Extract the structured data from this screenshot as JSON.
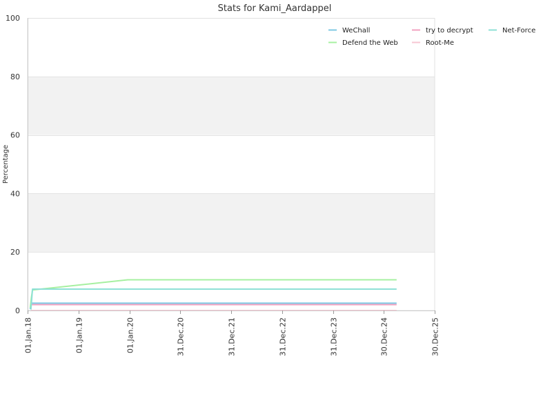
{
  "chart_data": {
    "type": "line",
    "title": "Stats for Kami_Aardappel",
    "xlabel": "",
    "ylabel": "Percentage",
    "ylim": [
      0,
      100
    ],
    "yticks": [
      0,
      20,
      40,
      60,
      80,
      100
    ],
    "xlim": [
      "2018-01-01",
      "2025-12-30"
    ],
    "xticks": [
      {
        "date": "2018-01-01",
        "label": "01.Jan.18"
      },
      {
        "date": "2019-01-01",
        "label": "01.Jan.19"
      },
      {
        "date": "2020-01-01",
        "label": "01.Jan.20"
      },
      {
        "date": "2020-12-31",
        "label": "31.Dec.20"
      },
      {
        "date": "2021-12-31",
        "label": "31.Dec.21"
      },
      {
        "date": "2022-12-31",
        "label": "31.Dec.22"
      },
      {
        "date": "2023-12-31",
        "label": "31.Dec.23"
      },
      {
        "date": "2024-12-30",
        "label": "30.Dec.24"
      },
      {
        "date": "2025-12-30",
        "label": "30.Dec.25"
      }
    ],
    "grid": true,
    "alternating_bands": true,
    "legend_position": "top-right",
    "series": [
      {
        "name": "WeChall",
        "color": "#7ec8e3",
        "points": [
          [
            "2018-01-20",
            0.5
          ],
          [
            "2018-01-25",
            2.5
          ],
          [
            "2025-04-01",
            2.5
          ]
        ]
      },
      {
        "name": "Defend the Web",
        "color": "#a6f0a0",
        "points": [
          [
            "2018-01-20",
            1.0
          ],
          [
            "2018-01-28",
            4.5
          ],
          [
            "2018-02-05",
            7.0
          ],
          [
            "2019-12-20",
            10.5
          ],
          [
            "2025-04-01",
            10.5
          ]
        ]
      },
      {
        "name": "try to decrypt",
        "color": "#f2a2c0",
        "points": [
          [
            "2018-01-25",
            2.0
          ],
          [
            "2025-04-01",
            2.0
          ]
        ]
      },
      {
        "name": "Root-Me",
        "color": "#f7c6d2",
        "points": [
          [
            "2018-01-25",
            0.0
          ],
          [
            "2025-04-01",
            0.0
          ]
        ]
      },
      {
        "name": "Net-Force",
        "color": "#8ee0d6",
        "points": [
          [
            "2018-01-25",
            0.3
          ],
          [
            "2018-02-05",
            7.3
          ],
          [
            "2025-04-01",
            7.3
          ]
        ]
      }
    ]
  }
}
